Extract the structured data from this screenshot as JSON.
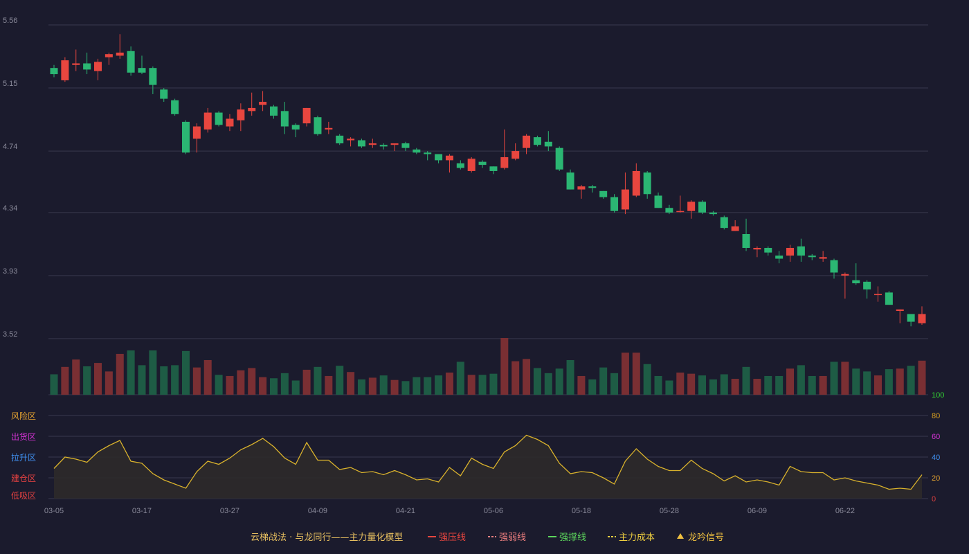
{
  "colors": {
    "background": "#1b1b2d",
    "up": "#e8463f",
    "down": "#2bb673",
    "vol_up": "#7a2f33",
    "vol_down": "#1e5c45",
    "grid": "#3a3a4e",
    "indicator_line": "#d9b22c",
    "indicator_fill": "#2e2a2a"
  },
  "legend": {
    "title": "云梯战法 · 与龙同行——主力量化模型",
    "items": [
      {
        "label": "强压线",
        "color": "#e8463f",
        "style": "solid"
      },
      {
        "label": "强弱线",
        "color": "#f08080",
        "style": "dashed"
      },
      {
        "label": "强撑线",
        "color": "#5cd65c",
        "style": "solid"
      },
      {
        "label": "主力成本",
        "color": "#f0d040",
        "style": "dashed"
      },
      {
        "label": "龙吟信号",
        "color": "#f0c040",
        "style": "triangle"
      }
    ]
  },
  "chart_data": [
    {
      "type": "candlestick",
      "title": "",
      "y_ticks": [
        "5.56",
        "5.15",
        "4.74",
        "4.34",
        "3.93",
        "3.52"
      ],
      "ylim": [
        3.52,
        5.56
      ],
      "x_tick_labels": [
        "03-05",
        "03-17",
        "03-27",
        "04-09",
        "04-21",
        "05-06",
        "05-18",
        "05-28",
        "06-09",
        "06-22"
      ],
      "x_tick_index": [
        0,
        8,
        16,
        24,
        32,
        40,
        48,
        56,
        64,
        72
      ],
      "grid": true,
      "ohlc": [
        [
          5.28,
          5.24,
          5.3,
          5.22
        ],
        [
          5.2,
          5.33,
          5.35,
          5.19
        ],
        [
          5.3,
          5.31,
          5.4,
          5.26
        ],
        [
          5.31,
          5.27,
          5.38,
          5.24
        ],
        [
          5.26,
          5.32,
          5.34,
          5.2
        ],
        [
          5.35,
          5.37,
          5.38,
          5.3
        ],
        [
          5.36,
          5.38,
          5.5,
          5.34
        ],
        [
          5.39,
          5.25,
          5.42,
          5.23
        ],
        [
          5.28,
          5.25,
          5.36,
          5.24
        ],
        [
          5.28,
          5.17,
          5.29,
          5.11
        ],
        [
          5.14,
          5.08,
          5.15,
          5.06
        ],
        [
          5.07,
          4.98,
          5.08,
          4.97
        ],
        [
          4.93,
          4.73,
          4.94,
          4.72
        ],
        [
          4.82,
          4.9,
          4.92,
          4.73
        ],
        [
          4.88,
          4.99,
          5.02,
          4.86
        ],
        [
          4.99,
          4.91,
          5.0,
          4.9
        ],
        [
          4.9,
          4.95,
          4.98,
          4.87
        ],
        [
          4.94,
          5.01,
          5.05,
          4.87
        ],
        [
          5.0,
          5.02,
          5.12,
          4.97
        ],
        [
          5.04,
          5.06,
          5.13,
          5.0
        ],
        [
          5.03,
          4.97,
          5.04,
          4.95
        ],
        [
          5.0,
          4.9,
          5.06,
          4.85
        ],
        [
          4.91,
          4.88,
          4.92,
          4.83
        ],
        [
          4.92,
          5.02,
          5.02,
          4.9
        ],
        [
          4.96,
          4.85,
          4.97,
          4.84
        ],
        [
          4.88,
          4.89,
          4.93,
          4.85
        ],
        [
          4.84,
          4.79,
          4.85,
          4.78
        ],
        [
          4.81,
          4.82,
          4.83,
          4.77
        ],
        [
          4.81,
          4.77,
          4.82,
          4.76
        ],
        [
          4.78,
          4.79,
          4.82,
          4.76
        ],
        [
          4.78,
          4.77,
          4.79,
          4.75
        ],
        [
          4.78,
          4.79,
          4.79,
          4.74
        ],
        [
          4.79,
          4.76,
          4.8,
          4.74
        ],
        [
          4.75,
          4.73,
          4.76,
          4.72
        ],
        [
          4.73,
          4.72,
          4.74,
          4.68
        ],
        [
          4.72,
          4.68,
          4.72,
          4.66
        ],
        [
          4.68,
          4.71,
          4.72,
          4.6
        ],
        [
          4.66,
          4.63,
          4.68,
          4.62
        ],
        [
          4.61,
          4.69,
          4.7,
          4.6
        ],
        [
          4.67,
          4.65,
          4.68,
          4.63
        ],
        [
          4.64,
          4.61,
          4.64,
          4.59
        ],
        [
          4.63,
          4.7,
          4.88,
          4.62
        ],
        [
          4.69,
          4.74,
          4.79,
          4.68
        ],
        [
          4.76,
          4.84,
          4.85,
          4.72
        ],
        [
          4.83,
          4.78,
          4.84,
          4.77
        ],
        [
          4.8,
          4.77,
          4.87,
          4.74
        ],
        [
          4.76,
          4.62,
          4.77,
          4.61
        ],
        [
          4.6,
          4.49,
          4.62,
          4.49
        ],
        [
          4.49,
          4.51,
          4.52,
          4.43
        ],
        [
          4.51,
          4.5,
          4.52,
          4.47
        ],
        [
          4.48,
          4.44,
          4.48,
          4.43
        ],
        [
          4.44,
          4.35,
          4.46,
          4.34
        ],
        [
          4.36,
          4.49,
          4.6,
          4.33
        ],
        [
          4.45,
          4.61,
          4.66,
          4.44
        ],
        [
          4.6,
          4.46,
          4.61,
          4.43
        ],
        [
          4.45,
          4.37,
          4.47,
          4.37
        ],
        [
          4.37,
          4.34,
          4.39,
          4.33
        ],
        [
          4.35,
          4.35,
          4.45,
          4.34
        ],
        [
          4.35,
          4.41,
          4.42,
          4.3
        ],
        [
          4.41,
          4.34,
          4.42,
          4.33
        ],
        [
          4.34,
          4.33,
          4.35,
          4.32
        ],
        [
          4.31,
          4.24,
          4.32,
          4.23
        ],
        [
          4.22,
          4.25,
          4.29,
          4.22
        ],
        [
          4.2,
          4.11,
          4.3,
          4.09
        ],
        [
          4.1,
          4.11,
          4.12,
          4.05
        ],
        [
          4.11,
          4.08,
          4.12,
          4.06
        ],
        [
          4.06,
          4.04,
          4.09,
          4.01
        ],
        [
          4.06,
          4.11,
          4.13,
          4.02
        ],
        [
          4.12,
          4.06,
          4.17,
          4.02
        ],
        [
          4.06,
          4.05,
          4.07,
          4.03
        ],
        [
          4.04,
          4.05,
          4.09,
          4.02
        ],
        [
          4.03,
          3.95,
          4.04,
          3.91
        ],
        [
          3.93,
          3.94,
          3.95,
          3.78
        ],
        [
          3.9,
          3.88,
          4.01,
          3.87
        ],
        [
          3.89,
          3.84,
          3.9,
          3.78
        ],
        [
          3.81,
          3.81,
          3.86,
          3.76
        ],
        [
          3.82,
          3.74,
          3.83,
          3.74
        ],
        [
          3.7,
          3.71,
          3.71,
          3.62
        ],
        [
          3.68,
          3.63,
          3.68,
          3.6
        ],
        [
          3.62,
          3.68,
          3.73,
          3.61
        ]
      ],
      "volume": [
        0.36,
        0.49,
        0.62,
        0.5,
        0.56,
        0.41,
        0.72,
        0.78,
        0.52,
        0.78,
        0.5,
        0.52,
        0.77,
        0.48,
        0.61,
        0.35,
        0.33,
        0.43,
        0.47,
        0.31,
        0.29,
        0.38,
        0.25,
        0.44,
        0.49,
        0.33,
        0.51,
        0.4,
        0.27,
        0.3,
        0.34,
        0.26,
        0.24,
        0.31,
        0.31,
        0.34,
        0.39,
        0.58,
        0.35,
        0.35,
        0.37,
        1.0,
        0.59,
        0.63,
        0.47,
        0.38,
        0.46,
        0.61,
        0.33,
        0.27,
        0.48,
        0.38,
        0.74,
        0.74,
        0.54,
        0.33,
        0.25,
        0.39,
        0.37,
        0.34,
        0.27,
        0.36,
        0.28,
        0.49,
        0.28,
        0.33,
        0.33,
        0.46,
        0.52,
        0.33,
        0.33,
        0.58,
        0.58,
        0.46,
        0.41,
        0.34,
        0.45,
        0.46,
        0.51,
        0.6
      ]
    },
    {
      "type": "area",
      "title": "",
      "ylim": [
        0,
        100
      ],
      "y_ticks": [
        {
          "value": 100,
          "label": "100",
          "color": "#33d633"
        },
        {
          "value": 80,
          "label": "80",
          "color": "#d9a020"
        },
        {
          "value": 60,
          "label": "60",
          "color": "#d633d6"
        },
        {
          "value": 40,
          "label": "40",
          "color": "#4090f0"
        },
        {
          "value": 20,
          "label": "20",
          "color": "#e0a030"
        },
        {
          "value": 0,
          "label": "0",
          "color": "#e04040"
        }
      ],
      "zones": [
        {
          "label": "风险区",
          "value": 80,
          "color": "#e0a030"
        },
        {
          "label": "出货区",
          "value": 60,
          "color": "#d633d6"
        },
        {
          "label": "拉升区",
          "value": 40,
          "color": "#4090f0"
        },
        {
          "label": "建仓区",
          "value": 20,
          "color": "#e04040"
        },
        {
          "label": "低吸区",
          "value": 0,
          "color": "#e04040"
        }
      ],
      "values": [
        29,
        40,
        38,
        35,
        45,
        51,
        56,
        36,
        34,
        24,
        18,
        14,
        10,
        26,
        36,
        33,
        39,
        47,
        52,
        58,
        50,
        39,
        33,
        54,
        37,
        37,
        28,
        30,
        25,
        26,
        23,
        27,
        23,
        18,
        19,
        16,
        30,
        22,
        39,
        33,
        29,
        45,
        51,
        61,
        57,
        51,
        34,
        24,
        26,
        25,
        20,
        14,
        36,
        48,
        38,
        31,
        27,
        27,
        37,
        29,
        24,
        17,
        22,
        16,
        18,
        16,
        13,
        31,
        26,
        25,
        25,
        18,
        20,
        17,
        15,
        13,
        9,
        10,
        9,
        23
      ]
    }
  ]
}
